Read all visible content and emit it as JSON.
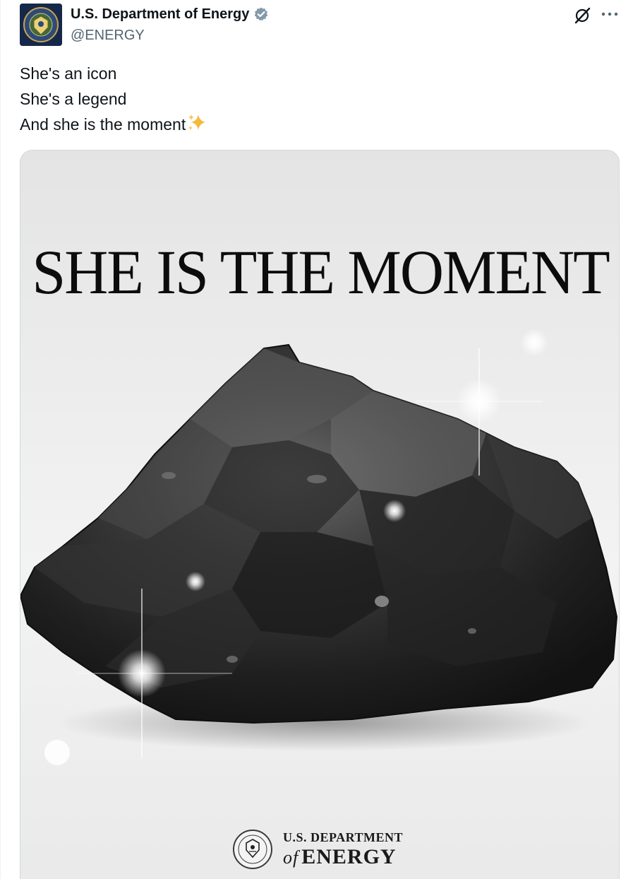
{
  "account": {
    "display_name": "U.S. Department of Energy",
    "handle": "@ENERGY",
    "verified": true,
    "avatar_icon": "doe-seal-avatar"
  },
  "actions": {
    "grok_icon": "grok-icon",
    "more_icon": "more-icon"
  },
  "tweet": {
    "lines": [
      "She's an icon",
      "She's a legend",
      "And she is the moment"
    ],
    "trailing_emoji": "sparkles-emoji"
  },
  "media": {
    "headline": "SHE IS THE MOMENT",
    "subject_icon": "coal-rock-image",
    "logo": {
      "seal_icon": "doe-seal-icon",
      "line1": "U.S. DEPARTMENT",
      "line2_of": "of",
      "line2": "ENERGY"
    }
  },
  "colors": {
    "text_primary": "#0f1419",
    "text_secondary": "#536471",
    "verified_badge": "#829aab",
    "border": "#cfd9de"
  }
}
